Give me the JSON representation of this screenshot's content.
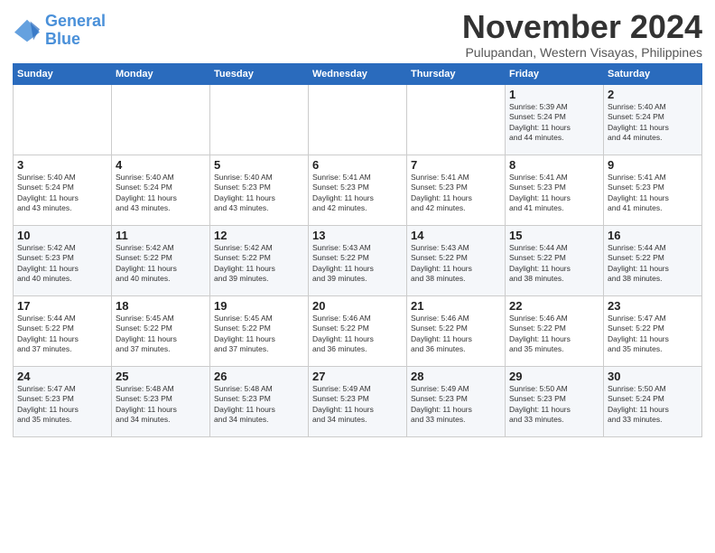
{
  "logo": {
    "line1": "General",
    "line2": "Blue"
  },
  "title": "November 2024",
  "subtitle": "Pulupandan, Western Visayas, Philippines",
  "days_of_week": [
    "Sunday",
    "Monday",
    "Tuesday",
    "Wednesday",
    "Thursday",
    "Friday",
    "Saturday"
  ],
  "weeks": [
    [
      {
        "num": "",
        "detail": ""
      },
      {
        "num": "",
        "detail": ""
      },
      {
        "num": "",
        "detail": ""
      },
      {
        "num": "",
        "detail": ""
      },
      {
        "num": "",
        "detail": ""
      },
      {
        "num": "1",
        "detail": "Sunrise: 5:39 AM\nSunset: 5:24 PM\nDaylight: 11 hours\nand 44 minutes."
      },
      {
        "num": "2",
        "detail": "Sunrise: 5:40 AM\nSunset: 5:24 PM\nDaylight: 11 hours\nand 44 minutes."
      }
    ],
    [
      {
        "num": "3",
        "detail": "Sunrise: 5:40 AM\nSunset: 5:24 PM\nDaylight: 11 hours\nand 43 minutes."
      },
      {
        "num": "4",
        "detail": "Sunrise: 5:40 AM\nSunset: 5:24 PM\nDaylight: 11 hours\nand 43 minutes."
      },
      {
        "num": "5",
        "detail": "Sunrise: 5:40 AM\nSunset: 5:23 PM\nDaylight: 11 hours\nand 43 minutes."
      },
      {
        "num": "6",
        "detail": "Sunrise: 5:41 AM\nSunset: 5:23 PM\nDaylight: 11 hours\nand 42 minutes."
      },
      {
        "num": "7",
        "detail": "Sunrise: 5:41 AM\nSunset: 5:23 PM\nDaylight: 11 hours\nand 42 minutes."
      },
      {
        "num": "8",
        "detail": "Sunrise: 5:41 AM\nSunset: 5:23 PM\nDaylight: 11 hours\nand 41 minutes."
      },
      {
        "num": "9",
        "detail": "Sunrise: 5:41 AM\nSunset: 5:23 PM\nDaylight: 11 hours\nand 41 minutes."
      }
    ],
    [
      {
        "num": "10",
        "detail": "Sunrise: 5:42 AM\nSunset: 5:23 PM\nDaylight: 11 hours\nand 40 minutes."
      },
      {
        "num": "11",
        "detail": "Sunrise: 5:42 AM\nSunset: 5:22 PM\nDaylight: 11 hours\nand 40 minutes."
      },
      {
        "num": "12",
        "detail": "Sunrise: 5:42 AM\nSunset: 5:22 PM\nDaylight: 11 hours\nand 39 minutes."
      },
      {
        "num": "13",
        "detail": "Sunrise: 5:43 AM\nSunset: 5:22 PM\nDaylight: 11 hours\nand 39 minutes."
      },
      {
        "num": "14",
        "detail": "Sunrise: 5:43 AM\nSunset: 5:22 PM\nDaylight: 11 hours\nand 38 minutes."
      },
      {
        "num": "15",
        "detail": "Sunrise: 5:44 AM\nSunset: 5:22 PM\nDaylight: 11 hours\nand 38 minutes."
      },
      {
        "num": "16",
        "detail": "Sunrise: 5:44 AM\nSunset: 5:22 PM\nDaylight: 11 hours\nand 38 minutes."
      }
    ],
    [
      {
        "num": "17",
        "detail": "Sunrise: 5:44 AM\nSunset: 5:22 PM\nDaylight: 11 hours\nand 37 minutes."
      },
      {
        "num": "18",
        "detail": "Sunrise: 5:45 AM\nSunset: 5:22 PM\nDaylight: 11 hours\nand 37 minutes."
      },
      {
        "num": "19",
        "detail": "Sunrise: 5:45 AM\nSunset: 5:22 PM\nDaylight: 11 hours\nand 37 minutes."
      },
      {
        "num": "20",
        "detail": "Sunrise: 5:46 AM\nSunset: 5:22 PM\nDaylight: 11 hours\nand 36 minutes."
      },
      {
        "num": "21",
        "detail": "Sunrise: 5:46 AM\nSunset: 5:22 PM\nDaylight: 11 hours\nand 36 minutes."
      },
      {
        "num": "22",
        "detail": "Sunrise: 5:46 AM\nSunset: 5:22 PM\nDaylight: 11 hours\nand 35 minutes."
      },
      {
        "num": "23",
        "detail": "Sunrise: 5:47 AM\nSunset: 5:22 PM\nDaylight: 11 hours\nand 35 minutes."
      }
    ],
    [
      {
        "num": "24",
        "detail": "Sunrise: 5:47 AM\nSunset: 5:23 PM\nDaylight: 11 hours\nand 35 minutes."
      },
      {
        "num": "25",
        "detail": "Sunrise: 5:48 AM\nSunset: 5:23 PM\nDaylight: 11 hours\nand 34 minutes."
      },
      {
        "num": "26",
        "detail": "Sunrise: 5:48 AM\nSunset: 5:23 PM\nDaylight: 11 hours\nand 34 minutes."
      },
      {
        "num": "27",
        "detail": "Sunrise: 5:49 AM\nSunset: 5:23 PM\nDaylight: 11 hours\nand 34 minutes."
      },
      {
        "num": "28",
        "detail": "Sunrise: 5:49 AM\nSunset: 5:23 PM\nDaylight: 11 hours\nand 33 minutes."
      },
      {
        "num": "29",
        "detail": "Sunrise: 5:50 AM\nSunset: 5:23 PM\nDaylight: 11 hours\nand 33 minutes."
      },
      {
        "num": "30",
        "detail": "Sunrise: 5:50 AM\nSunset: 5:24 PM\nDaylight: 11 hours\nand 33 minutes."
      }
    ]
  ]
}
